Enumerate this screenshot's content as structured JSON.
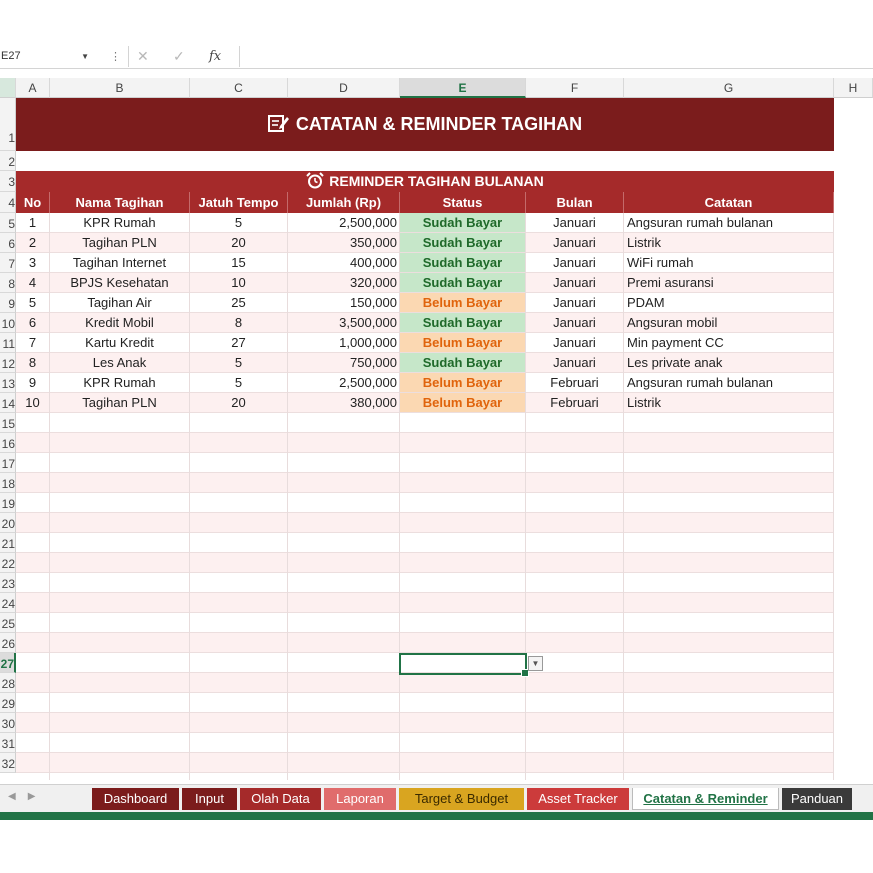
{
  "formula_bar": {
    "name_box": "E27",
    "fx": "fx"
  },
  "columns": [
    "A",
    "B",
    "C",
    "D",
    "E",
    "F",
    "G",
    "H"
  ],
  "active_column": "E",
  "rows": [
    "1",
    "2",
    "3",
    "4",
    "5",
    "6",
    "7",
    "8",
    "9",
    "10",
    "11",
    "12",
    "13",
    "14",
    "15",
    "16",
    "17",
    "18",
    "19",
    "20",
    "21",
    "22",
    "23",
    "24",
    "25",
    "26",
    "27",
    "28",
    "29",
    "30",
    "31",
    "32"
  ],
  "active_row": "27",
  "title": "CATATAN & REMINDER TAGIHAN",
  "section_title": "REMINDER TAGIHAN BULANAN",
  "table": {
    "headers": [
      "No",
      "Nama Tagihan",
      "Jatuh Tempo",
      "Jumlah (Rp)",
      "Status",
      "Bulan",
      "Catatan"
    ],
    "rows": [
      {
        "no": "1",
        "nama": "KPR Rumah",
        "jatuh": "5",
        "jumlah": "2,500,000",
        "status": "Sudah Bayar",
        "bulan": "Januari",
        "catatan": "Angsuran rumah bulanan"
      },
      {
        "no": "2",
        "nama": "Tagihan PLN",
        "jatuh": "20",
        "jumlah": "350,000",
        "status": "Sudah Bayar",
        "bulan": "Januari",
        "catatan": "Listrik"
      },
      {
        "no": "3",
        "nama": "Tagihan Internet",
        "jatuh": "15",
        "jumlah": "400,000",
        "status": "Sudah Bayar",
        "bulan": "Januari",
        "catatan": "WiFi rumah"
      },
      {
        "no": "4",
        "nama": "BPJS Kesehatan",
        "jatuh": "10",
        "jumlah": "320,000",
        "status": "Sudah Bayar",
        "bulan": "Januari",
        "catatan": "Premi asuransi"
      },
      {
        "no": "5",
        "nama": "Tagihan Air",
        "jatuh": "25",
        "jumlah": "150,000",
        "status": "Belum Bayar",
        "bulan": "Januari",
        "catatan": "PDAM"
      },
      {
        "no": "6",
        "nama": "Kredit Mobil",
        "jatuh": "8",
        "jumlah": "3,500,000",
        "status": "Sudah Bayar",
        "bulan": "Januari",
        "catatan": "Angsuran mobil"
      },
      {
        "no": "7",
        "nama": "Kartu Kredit",
        "jatuh": "27",
        "jumlah": "1,000,000",
        "status": "Belum Bayar",
        "bulan": "Januari",
        "catatan": "Min payment CC"
      },
      {
        "no": "8",
        "nama": "Les Anak",
        "jatuh": "5",
        "jumlah": "750,000",
        "status": "Sudah Bayar",
        "bulan": "Januari",
        "catatan": "Les private anak"
      },
      {
        "no": "9",
        "nama": "KPR Rumah",
        "jatuh": "5",
        "jumlah": "2,500,000",
        "status": "Belum Bayar",
        "bulan": "Februari",
        "catatan": "Angsuran rumah bulanan"
      },
      {
        "no": "10",
        "nama": "Tagihan PLN",
        "jatuh": "20",
        "jumlah": "380,000",
        "status": "Belum Bayar",
        "bulan": "Februari",
        "catatan": "Listrik"
      }
    ]
  },
  "colors": {
    "banner": "#7b1c1c",
    "header": "#a52a2a",
    "paid_bg": "#c6e7c9",
    "paid_text": "#1f6a2a",
    "unpaid_bg": "#fbd8b2",
    "unpaid_text": "#e0640c",
    "excel_green": "#217346"
  },
  "tabs": [
    {
      "label": "Dashboard",
      "color": "#7b1c1c"
    },
    {
      "label": "Input",
      "color": "#7b1c1c"
    },
    {
      "label": "Olah Data",
      "color": "#a52a2a"
    },
    {
      "label": "Laporan",
      "color": "#e06c6c"
    },
    {
      "label": "Target & Budget",
      "color": "#d9a520"
    },
    {
      "label": "Asset Tracker",
      "color": "#cc3b3b"
    },
    {
      "label": "Catatan & Reminder",
      "color": "#ffffff",
      "active": true
    },
    {
      "label": "Panduan",
      "color": "#3a3a3a"
    }
  ],
  "icons": {
    "title_icon": "edit-note-icon",
    "section_icon": "alarm-clock-icon"
  }
}
